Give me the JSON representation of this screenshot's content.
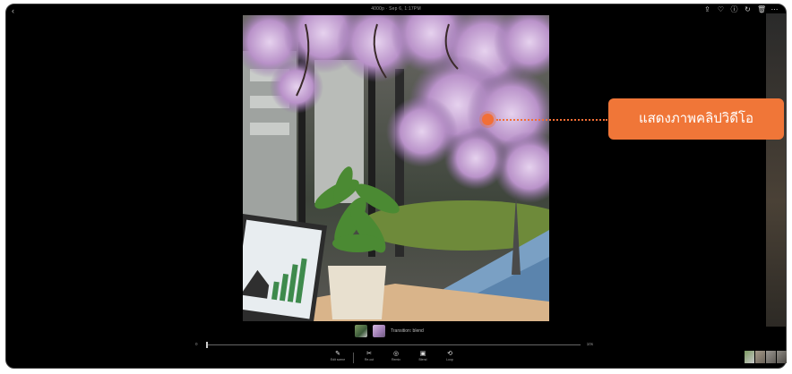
{
  "header": {
    "title": "4000p · Sep 6, 1:17PM",
    "tools": [
      {
        "icon": "share-icon",
        "glyph": "⇪"
      },
      {
        "icon": "heart-icon",
        "glyph": "♡"
      },
      {
        "icon": "info-icon",
        "glyph": "ⓘ"
      },
      {
        "icon": "rotate-icon",
        "glyph": "↻"
      },
      {
        "icon": "trash-icon",
        "glyph": "🗑"
      },
      {
        "icon": "more-icon",
        "glyph": "⋯"
      }
    ]
  },
  "annotation": {
    "label": "แสดงภาพคลิปวิดีโอ",
    "color": "#f26f36"
  },
  "filmstrip": {
    "transition_label": "Transition: blend"
  },
  "timeline": {
    "start": "0",
    "end": "10s",
    "progress": 0
  },
  "actions": [
    {
      "label": "Edit scene",
      "icon": "pencil-icon",
      "glyph": "✎"
    },
    {
      "label": "Re-cut",
      "icon": "scissors-icon",
      "glyph": "✂"
    },
    {
      "label": "Remix",
      "icon": "remix-icon",
      "glyph": "◎"
    },
    {
      "label": "Blend",
      "icon": "blend-icon",
      "glyph": "▣"
    },
    {
      "label": "Loop",
      "icon": "loop-icon",
      "glyph": "⟲"
    }
  ]
}
